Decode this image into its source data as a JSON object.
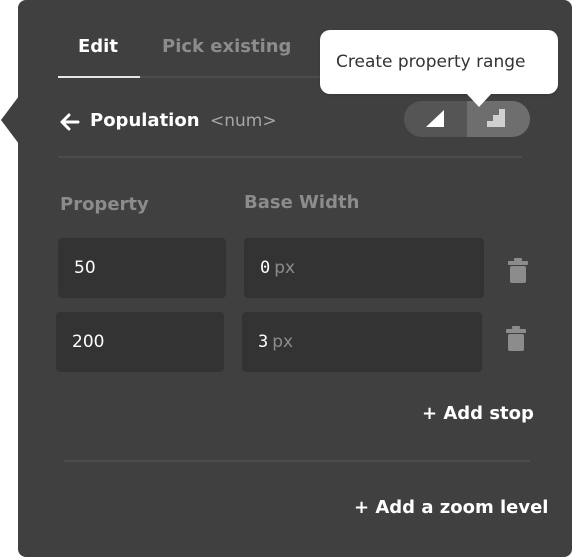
{
  "tabs": [
    {
      "label": "Edit",
      "active": true
    },
    {
      "label": "Pick existing",
      "active": false
    }
  ],
  "tooltip": {
    "text": "Create property range"
  },
  "property": {
    "name": "Population",
    "type": "<num>"
  },
  "toggle": {
    "options": [
      "linear-ramp-icon",
      "step-icon"
    ],
    "selected": "step-icon"
  },
  "columns": {
    "property": "Property",
    "base_width": "Base Width"
  },
  "stops": [
    {
      "property": "50",
      "width": "0",
      "unit": "px"
    },
    {
      "property": "200",
      "width": "3",
      "unit": "px"
    }
  ],
  "actions": {
    "add_stop": "+ Add stop",
    "add_zoom_level": "+ Add a zoom level"
  },
  "colors": {
    "panel_bg": "#404040",
    "field_bg": "#333333",
    "muted_text": "#8c8c8c",
    "tooltip_bg": "#ffffff"
  }
}
